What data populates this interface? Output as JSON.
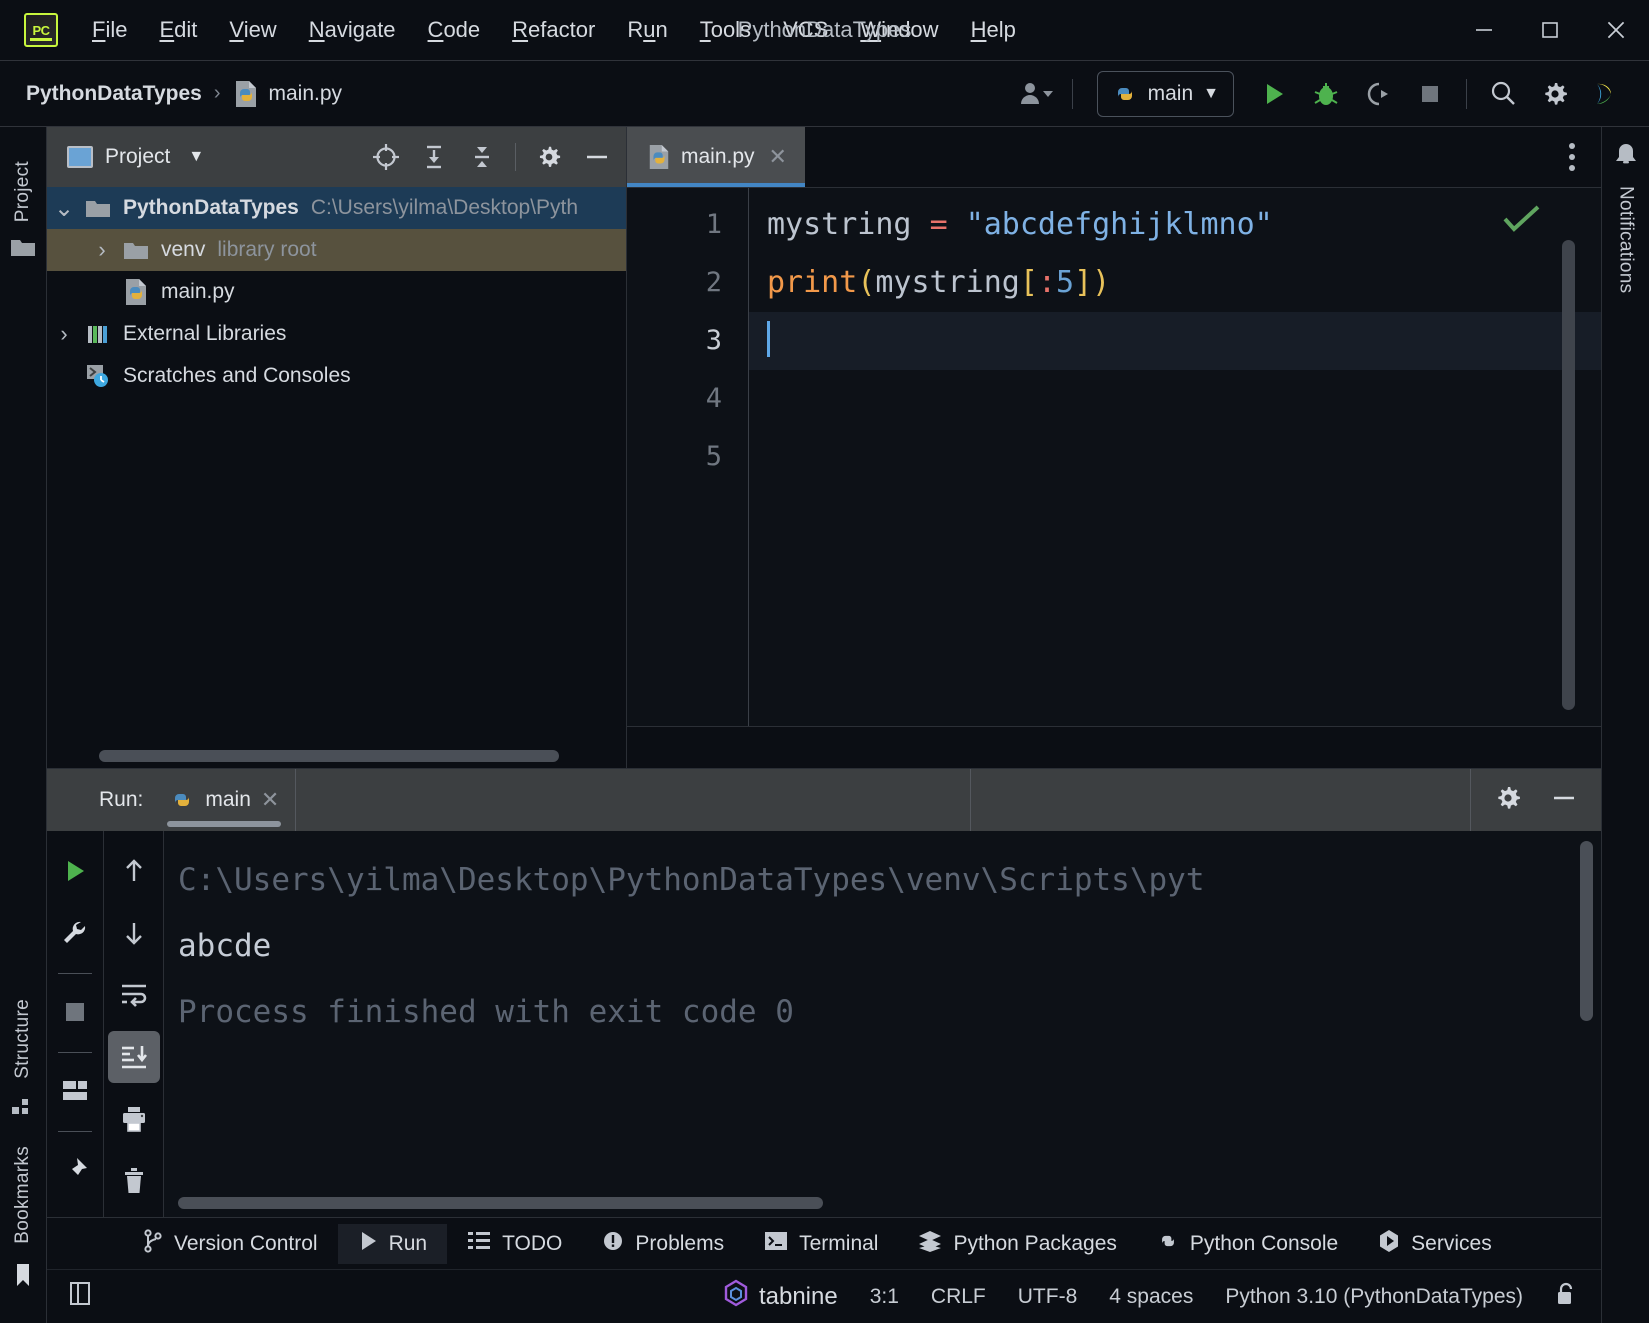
{
  "window": {
    "title": "PythonDataTypes",
    "app_logo": "pycharm-logo",
    "minimize": "minimize-icon",
    "maximize": "maximize-icon",
    "close": "close-icon"
  },
  "menubar": {
    "items": [
      {
        "label": "File",
        "mnemonic": "F"
      },
      {
        "label": "Edit",
        "mnemonic": "E"
      },
      {
        "label": "View",
        "mnemonic": "V"
      },
      {
        "label": "Navigate",
        "mnemonic": "N"
      },
      {
        "label": "Code",
        "mnemonic": "C"
      },
      {
        "label": "Refactor",
        "mnemonic": "R"
      },
      {
        "label": "Run",
        "mnemonic": "u"
      },
      {
        "label": "Tools",
        "mnemonic": "T"
      },
      {
        "label": "VCS",
        "mnemonic": ""
      },
      {
        "label": "Window",
        "mnemonic": "W"
      },
      {
        "label": "Help",
        "mnemonic": "H"
      }
    ]
  },
  "toolbar": {
    "breadcrumb_project": "PythonDataTypes",
    "breadcrumb_sep": "›",
    "breadcrumb_file": "main.py",
    "run_config_label": "main",
    "run_config_caret": "▼",
    "buttons": [
      "avatar-dropdown-icon",
      "run-icon",
      "debug-icon",
      "coverage-icon",
      "stop-icon",
      "search-everywhere-icon",
      "settings-icon",
      "ide-help-icon"
    ]
  },
  "left_stripe": {
    "tabs": [
      "Project",
      "Structure",
      "Bookmarks"
    ]
  },
  "right_stripe": {
    "notifications_label": "Notifications",
    "bell": "bell-icon"
  },
  "project_panel": {
    "header_title": "Project",
    "header_caret": "▼",
    "tools": [
      "locate-icon",
      "expand-all-icon",
      "collapse-all-icon",
      "settings-icon",
      "hide-icon"
    ],
    "tree": [
      {
        "label": "PythonDataTypes",
        "secondary": "C:\\Users\\yilma\\Desktop\\Pyth",
        "icon": "folder-icon",
        "arrow": "⌄",
        "expanded": true,
        "selected": "blue",
        "indent": 0,
        "bold": true
      },
      {
        "label": "venv",
        "secondary": "library root",
        "icon": "folder-icon",
        "arrow": "›",
        "expanded": false,
        "selected": "olive",
        "indent": 1,
        "bold": false
      },
      {
        "label": "main.py",
        "secondary": "",
        "icon": "python-file-icon",
        "arrow": "",
        "expanded": false,
        "selected": "none",
        "indent": 1,
        "bold": false
      },
      {
        "label": "External Libraries",
        "secondary": "",
        "icon": "libraries-icon",
        "arrow": "›",
        "expanded": false,
        "selected": "none",
        "indent": 0,
        "bold": false
      },
      {
        "label": "Scratches and Consoles",
        "secondary": "",
        "icon": "scratches-icon",
        "arrow": "",
        "expanded": false,
        "selected": "none",
        "indent": 0,
        "bold": false
      }
    ]
  },
  "editor": {
    "tab_label": "main.py",
    "tab_icon": "python-file-icon",
    "tab_close": "✕",
    "more_menu": "more-options-icon",
    "inspection_status": "ok-check-icon",
    "line_numbers": [
      "1",
      "2",
      "3",
      "4",
      "5"
    ],
    "current_line": 3,
    "lines": [
      {
        "n": 1,
        "text": "mystring = \"abcdefghijklmno\""
      },
      {
        "n": 2,
        "text": "print(mystring[:5])"
      },
      {
        "n": 3,
        "text": ""
      },
      {
        "n": 4,
        "text": ""
      },
      {
        "n": 5,
        "text": ""
      }
    ],
    "tokens_line1": [
      {
        "t": "mystring ",
        "c": "t-var"
      },
      {
        "t": "= ",
        "c": "t-op"
      },
      {
        "t": "\"abcdefghijklmno\"",
        "c": "t-str"
      }
    ],
    "tokens_line2": [
      {
        "t": "print",
        "c": "t-fn"
      },
      {
        "t": "(",
        "c": "t-paren"
      },
      {
        "t": "mystring",
        "c": "t-var"
      },
      {
        "t": "[",
        "c": "t-brk"
      },
      {
        "t": ":",
        "c": "t-op"
      },
      {
        "t": "5",
        "c": "t-num"
      },
      {
        "t": "]",
        "c": "t-brk"
      },
      {
        "t": ")",
        "c": "t-paren"
      }
    ]
  },
  "run_panel": {
    "label": "Run:",
    "tab_label": "main",
    "tab_icon": "python-icon",
    "tab_close": "✕",
    "settings": "settings-icon",
    "hide": "hide-icon",
    "left_tools": [
      "rerun-icon",
      "wrench-icon",
      "stop-icon",
      "layout-icon",
      "pin-icon"
    ],
    "mid_tools": [
      "up-arrow-icon",
      "down-arrow-icon",
      "soft-wrap-icon",
      "scroll-to-end-icon",
      "print-icon",
      "trash-icon"
    ],
    "console": [
      {
        "text": "C:\\Users\\yilma\\Desktop\\PythonDataTypes\\venv\\Scripts\\pyt",
        "kind": "system"
      },
      {
        "text": "abcde",
        "kind": "output"
      },
      {
        "text": "",
        "kind": "system"
      },
      {
        "text": "Process finished with exit code 0",
        "kind": "system"
      }
    ]
  },
  "tool_window_bar": {
    "items": [
      {
        "label": "Version Control",
        "icon": "branch-icon",
        "active": false
      },
      {
        "label": "Run",
        "icon": "run-icon",
        "active": true
      },
      {
        "label": "TODO",
        "icon": "todo-list-icon",
        "active": false
      },
      {
        "label": "Problems",
        "icon": "problems-icon",
        "active": false
      },
      {
        "label": "Terminal",
        "icon": "terminal-icon",
        "active": false
      },
      {
        "label": "Python Packages",
        "icon": "packages-icon",
        "active": false
      },
      {
        "label": "Python Console",
        "icon": "python-icon",
        "active": false
      },
      {
        "label": "Services",
        "icon": "services-icon",
        "active": false
      }
    ]
  },
  "status_bar": {
    "left_icon": "toggle-tool-window-icon",
    "tabnine": "tabnine",
    "tabnine_icon": "tabnine-logo-icon",
    "caret_position": "3:1",
    "line_separator": "CRLF",
    "encoding": "UTF-8",
    "indent": "4 spaces",
    "interpreter": "Python 3.10 (PythonDataTypes)",
    "lock_icon": "unlocked-icon"
  },
  "colors": {
    "accent_blue": "#4386c4",
    "string_blue": "#7fb2e5",
    "function_orange": "#f2994a",
    "operator_red": "#e8726a",
    "bracket_yellow": "#e8c25a",
    "number_blue": "#6aa3d5",
    "selection_blue": "#1d3b56",
    "selection_olive": "#57513e",
    "panel_gray": "#3c3f41",
    "editor_bg": "#0d1117",
    "run_green": "#4eb24e",
    "check_green": "#5fa55f",
    "pycharm_green": "#c8f63d"
  }
}
